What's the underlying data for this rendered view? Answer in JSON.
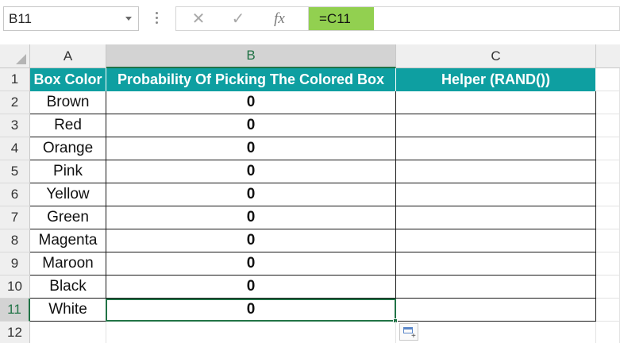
{
  "formula_bar": {
    "name_box": "B11",
    "cancel_icon": "cross-icon",
    "enter_icon": "check-icon",
    "fx_label": "fx",
    "formula": "=C11",
    "formula_highlight": "#92d050"
  },
  "columns": [
    "A",
    "B",
    "C"
  ],
  "selected_column": "B",
  "header_fill": "#0e9fa1",
  "rows": [
    {
      "num": "1",
      "a": "Box Color",
      "b": "Probability Of Picking The Colored Box",
      "c": "Helper (RAND())"
    },
    {
      "num": "2",
      "a": "Brown",
      "b": "0",
      "c": ""
    },
    {
      "num": "3",
      "a": "Red",
      "b": "0",
      "c": ""
    },
    {
      "num": "4",
      "a": "Orange",
      "b": "0",
      "c": ""
    },
    {
      "num": "5",
      "a": "Pink",
      "b": "0",
      "c": ""
    },
    {
      "num": "6",
      "a": "Yellow",
      "b": "0",
      "c": ""
    },
    {
      "num": "7",
      "a": "Green",
      "b": "0",
      "c": ""
    },
    {
      "num": "8",
      "a": "Magenta",
      "b": "0",
      "c": ""
    },
    {
      "num": "9",
      "a": "Maroon",
      "b": "0",
      "c": ""
    },
    {
      "num": "10",
      "a": "Black",
      "b": "0",
      "c": ""
    },
    {
      "num": "11",
      "a": "White",
      "b": "0",
      "c": ""
    },
    {
      "num": "12",
      "a": "",
      "b": "",
      "c": ""
    }
  ]
}
